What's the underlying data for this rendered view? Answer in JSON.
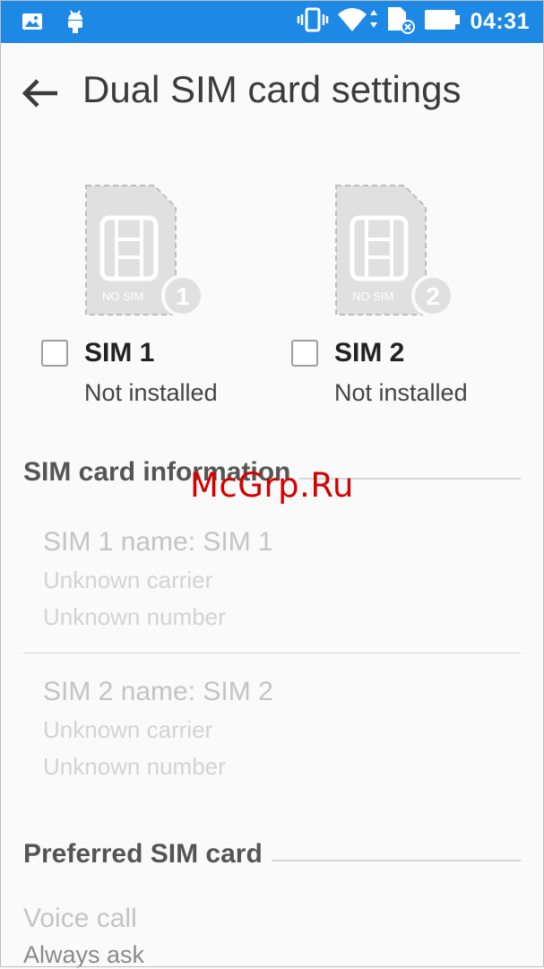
{
  "status_bar": {
    "time": "04:31",
    "background": "#1e88e5",
    "left_icons": [
      "image-notification-icon",
      "android-debug-icon"
    ],
    "right_icons": [
      "vibrate-icon",
      "wifi-icon",
      "no-sim-icon",
      "battery-icon"
    ]
  },
  "toolbar": {
    "title": "Dual SIM card settings"
  },
  "sims": [
    {
      "name": "SIM 1",
      "status": "Not installed",
      "card_text": "NO SIM",
      "badge": "1",
      "checked": false
    },
    {
      "name": "SIM 2",
      "status": "Not installed",
      "card_text": "NO SIM",
      "badge": "2",
      "checked": false
    }
  ],
  "sim_info": {
    "header": "SIM card information",
    "items": [
      {
        "title": "SIM 1 name: SIM 1",
        "carrier": "Unknown carrier",
        "number": "Unknown number"
      },
      {
        "title": "SIM 2 name: SIM 2",
        "carrier": "Unknown carrier",
        "number": "Unknown number"
      }
    ]
  },
  "preferred": {
    "header": "Preferred SIM card",
    "items": [
      {
        "title": "Voice call",
        "value": "Always ask"
      }
    ]
  },
  "watermark": "McGrp.Ru"
}
